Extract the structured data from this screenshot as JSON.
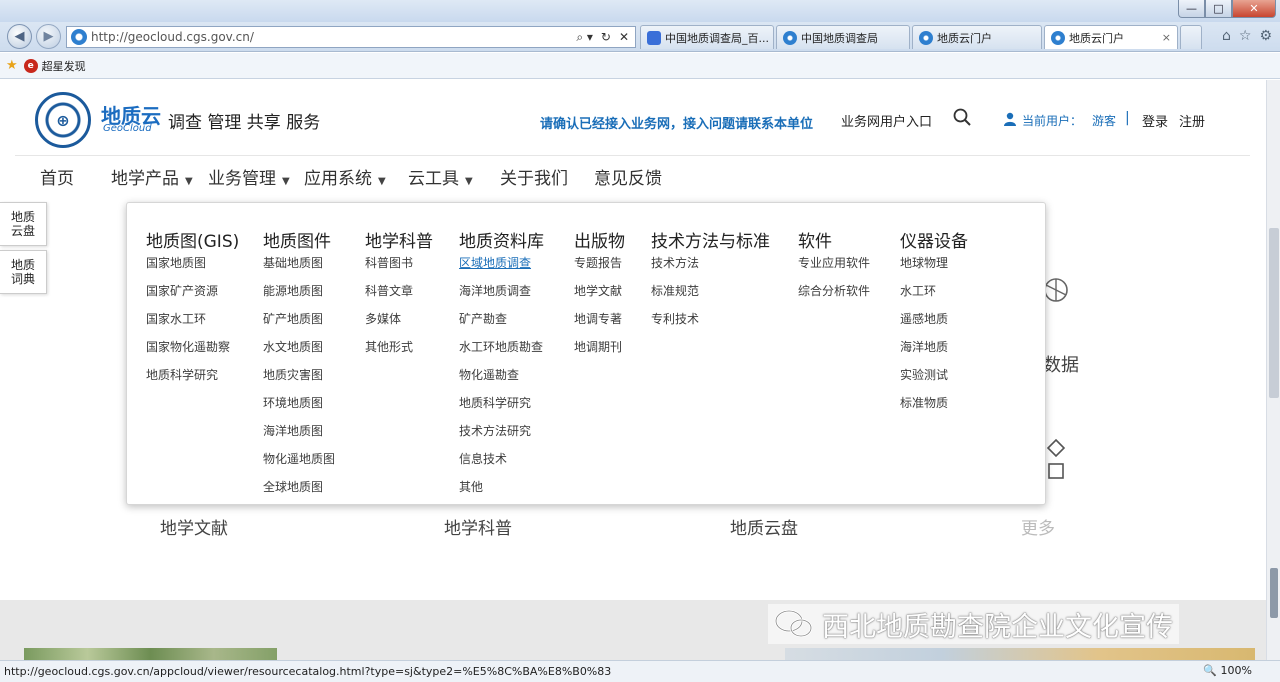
{
  "browser": {
    "window_buttons": [
      "—",
      "□",
      "✕"
    ],
    "address_url": "http://geocloud.cgs.gov.cn/",
    "address_actions": [
      "⌕ ▾",
      "↻",
      "✕"
    ],
    "tabs": [
      {
        "label": "中国地质调查局_百...",
        "active": false
      },
      {
        "label": "中国地质调查局",
        "active": false
      },
      {
        "label": "地质云门户",
        "active": false
      },
      {
        "label": "地质云门户",
        "active": true,
        "close": "×"
      }
    ],
    "toolbar_icons": [
      "⌂",
      "☆",
      "⚙"
    ],
    "favorites": [
      {
        "label": "超星发现"
      }
    ],
    "status_url": "http://geocloud.cgs.gov.cn/appcloud/viewer/resourcecatalog.html?type=sj&type2=%E5%8C%BA%E8%B0%83",
    "zoom": "🔍 100%"
  },
  "header": {
    "logo_name": "地质云",
    "logo_sub": "GeoCloud",
    "slogan": "调查 管理 共享 服务",
    "notice": "请确认已经接入业务网，接入问题请联系本单位",
    "biz_entry": "业务网用户入口",
    "user_label": "当前用户：",
    "user_name": "游客",
    "user_sep": "|",
    "login": "登录",
    "register": "注册"
  },
  "nav": [
    {
      "label": "首页",
      "dropdown": false
    },
    {
      "label": "地学产品",
      "dropdown": true
    },
    {
      "label": "业务管理",
      "dropdown": true
    },
    {
      "label": "应用系统",
      "dropdown": true
    },
    {
      "label": "云工具",
      "dropdown": true
    },
    {
      "label": "关于我们",
      "dropdown": false
    },
    {
      "label": "意见反馈",
      "dropdown": false
    }
  ],
  "side_tabs": [
    {
      "label": "地质云盘"
    },
    {
      "label": "地质词典"
    }
  ],
  "mega_menu": {
    "columns": [
      {
        "title": "地质图(GIS)",
        "links": [
          "国家地质图",
          "国家矿产资源",
          "国家水工环",
          "国家物化遥勘察",
          "地质科学研究"
        ]
      },
      {
        "title": "地质图件",
        "links": [
          "基础地质图",
          "能源地质图",
          "矿产地质图",
          "水文地质图",
          "地质灾害图",
          "环境地质图",
          "海洋地质图",
          "物化遥地质图",
          "全球地质图"
        ]
      },
      {
        "title": "地学科普",
        "links": [
          "科普图书",
          "科普文章",
          "多媒体",
          "其他形式"
        ]
      },
      {
        "title": "地质资料库",
        "links": [
          "区域地质调查",
          "海洋地质调查",
          "矿产勘查",
          "水工环地质勘查",
          "物化遥勘查",
          "地质科学研究",
          "技术方法研究",
          "信息技术",
          "其他"
        ],
        "active_index": 0
      },
      {
        "title": "出版物",
        "links": [
          "专题报告",
          "地学文献",
          "地调专著",
          "地调期刊"
        ]
      },
      {
        "title": "技术方法与标准",
        "links": [
          "技术方法",
          "标准规范",
          "专利技术"
        ]
      },
      {
        "title": "软件",
        "links": [
          "专业应用软件",
          "综合分析软件"
        ]
      },
      {
        "title": "仪器设备",
        "links": [
          "地球物理",
          "水工环",
          "遥感地质",
          "海洋地质",
          "实验测试",
          "标准物质"
        ]
      }
    ]
  },
  "background": {
    "partial_label": "数据",
    "tiles": [
      "地学文献",
      "地学科普",
      "地质云盘",
      "更多"
    ]
  },
  "watermark": {
    "text": "西北地质勘查院企业文化宣传"
  },
  "colors": {
    "brand_blue": "#1b6cc0",
    "link_blue": "#1a6eb8"
  }
}
